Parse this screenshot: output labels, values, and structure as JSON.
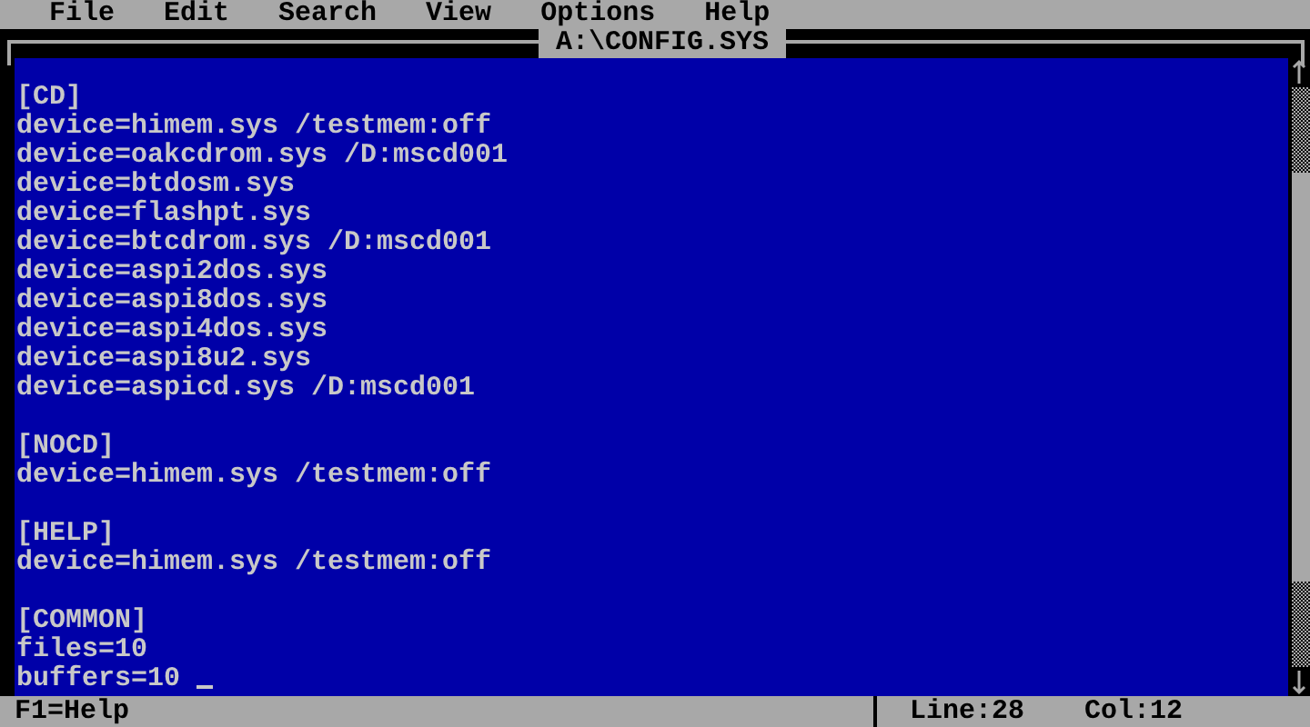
{
  "menu": [
    {
      "label": "File"
    },
    {
      "label": "Edit"
    },
    {
      "label": "Search"
    },
    {
      "label": "View"
    },
    {
      "label": "Options"
    },
    {
      "label": "Help"
    }
  ],
  "window": {
    "title": "A:\\CONFIG.SYS"
  },
  "editor": {
    "sections": [
      {
        "lines": [
          "[CD]",
          "device=himem.sys /testmem:off",
          "device=oakcdrom.sys /D:mscd001",
          "device=btdosm.sys",
          "device=flashpt.sys",
          "device=btcdrom.sys /D:mscd001",
          "device=aspi2dos.sys",
          "device=aspi8dos.sys",
          "device=aspi4dos.sys",
          "device=aspi8u2.sys",
          "device=aspicd.sys /D:mscd001"
        ]
      },
      {
        "lines": [
          "[NOCD]",
          "device=himem.sys /testmem:off"
        ]
      },
      {
        "lines": [
          "[HELP]",
          "device=himem.sys /testmem:off"
        ]
      },
      {
        "lines": [
          "[COMMON]",
          "files=10",
          "buffers=10"
        ]
      }
    ]
  },
  "status_bar": {
    "hint": "F1=Help",
    "line": "Line:28",
    "column": "Col:12"
  }
}
